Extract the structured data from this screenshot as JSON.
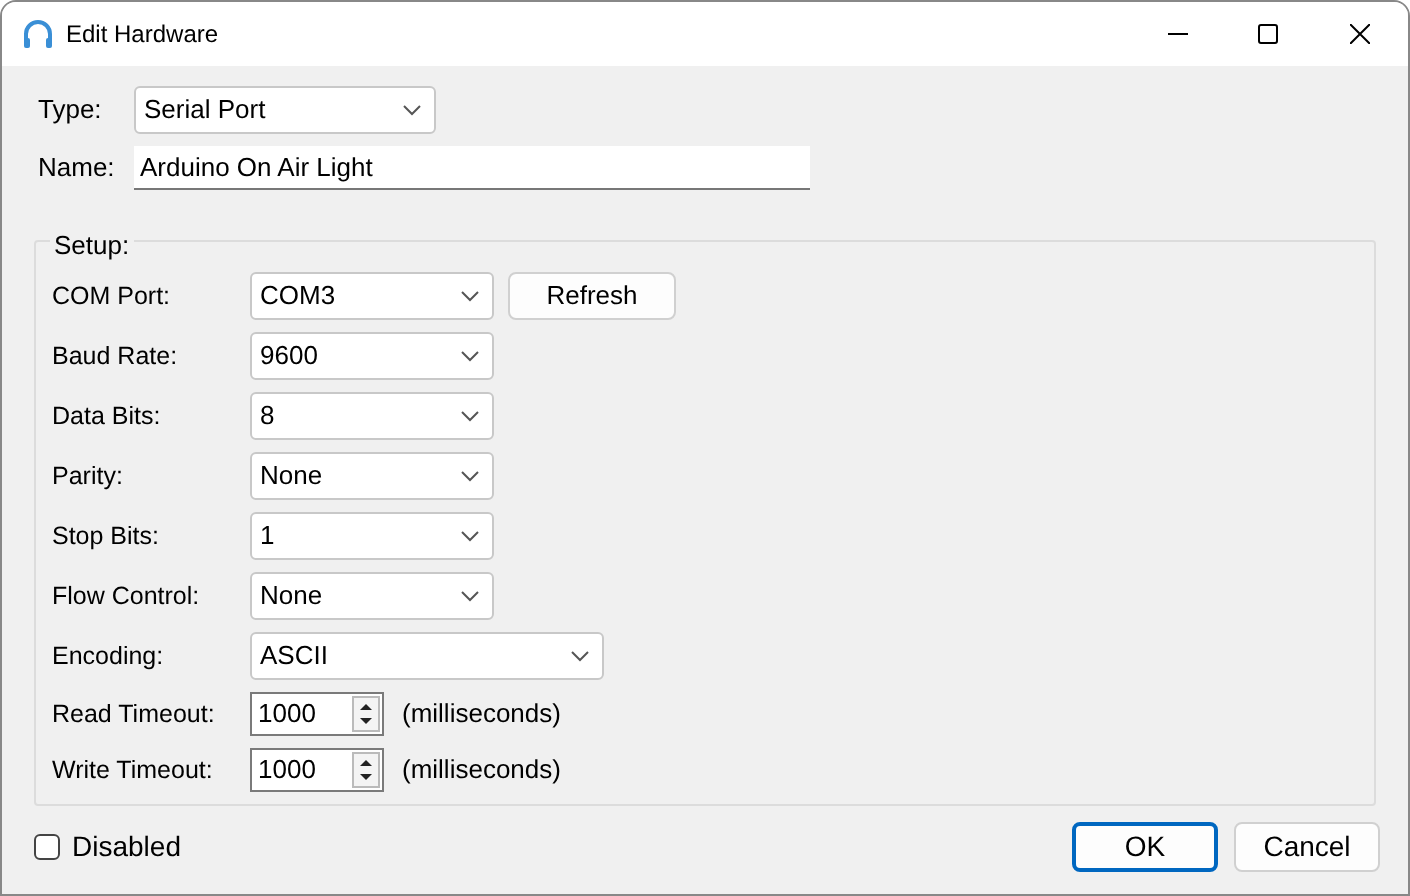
{
  "window": {
    "title": "Edit Hardware"
  },
  "type": {
    "label": "Type:",
    "value": "Serial Port"
  },
  "name": {
    "label": "Name:",
    "value": "Arduino On Air Light"
  },
  "setup": {
    "title": "Setup:",
    "fields": [
      {
        "kind": "combo",
        "label": "COM Port:",
        "value": "COM3",
        "button": "Refresh"
      },
      {
        "kind": "combo",
        "label": "Baud Rate:",
        "value": "9600"
      },
      {
        "kind": "combo",
        "label": "Data Bits:",
        "value": "8"
      },
      {
        "kind": "combo",
        "label": "Parity:",
        "value": "None"
      },
      {
        "kind": "combo",
        "label": "Stop Bits:",
        "value": "1"
      },
      {
        "kind": "combo",
        "label": "Flow Control:",
        "value": "None"
      },
      {
        "kind": "wide-combo",
        "label": "Encoding:",
        "value": "ASCII"
      },
      {
        "kind": "spin",
        "label": "Read Timeout:",
        "value": "1000",
        "units": "(milliseconds)"
      },
      {
        "kind": "spin",
        "label": "Write Timeout:",
        "value": "1000",
        "units": "(milliseconds)"
      }
    ]
  },
  "disabled": {
    "label": "Disabled",
    "checked": false
  },
  "buttons": [
    {
      "label": "OK",
      "default": true
    },
    {
      "label": "Cancel",
      "default": false
    }
  ]
}
